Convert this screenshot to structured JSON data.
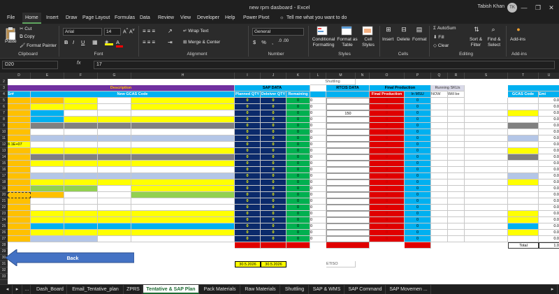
{
  "window": {
    "title": "new rpm dasboard  -  Excel",
    "user": "Tabish Khan",
    "avatar_initials": "TK",
    "minimize": "—",
    "restore": "❐",
    "close": "✕"
  },
  "ribbon_tabs": [
    "File",
    "Home",
    "Insert",
    "Draw",
    "Page Layout",
    "Formulas",
    "Data",
    "Review",
    "View",
    "Developer",
    "Help",
    "Power Pivot"
  ],
  "tell_me": "Tell me what you want to do",
  "ribbon": {
    "clipboard": {
      "paste": "Paste",
      "cut": "Cut",
      "copy": "Copy",
      "format_painter": "Format Painter",
      "label": "Clipboard"
    },
    "font": {
      "name": "Arial",
      "size": "14",
      "label": "Font"
    },
    "alignment": {
      "wrap": "Wrap Text",
      "merge": "Merge & Center",
      "label": "Alignment"
    },
    "number": {
      "format": "General",
      "label": "Number"
    },
    "styles": {
      "conditional": "Conditional Formatting",
      "format_table": "Format as Table",
      "cell_styles": "Cell Styles",
      "label": "Styles"
    },
    "cells": {
      "insert": "Insert",
      "delete": "Delete",
      "format": "Format",
      "label": "Cells"
    },
    "editing": {
      "autosum": "AutoSum",
      "fill": "Fill",
      "clear": "Clear",
      "sort": "Sort & Filter",
      "find": "Find & Select",
      "label": "Editing"
    },
    "addins": {
      "addins": "Add-ins",
      "label": "Add-ins"
    }
  },
  "formula_bar": {
    "name_box": "D20",
    "fx": "fx",
    "value": "17"
  },
  "columns": [
    "D",
    "E",
    "F",
    "G",
    "H",
    "I",
    "J",
    "K",
    "L",
    "M",
    "N",
    "O",
    "P",
    "Q",
    "R",
    "S",
    "T",
    "U"
  ],
  "rows": [
    "1",
    "2",
    "3",
    "4",
    "5",
    "6",
    "7",
    "8",
    "9",
    "10",
    "11",
    "12",
    "13",
    "14",
    "15",
    "16",
    "17",
    "18",
    "19",
    "20",
    "21",
    "22",
    "23",
    "24",
    "25",
    "26",
    "27",
    "28",
    "29",
    "30",
    "31",
    "32",
    "33"
  ],
  "sheet": {
    "shuttling": "Shuttling",
    "description": "Description",
    "new_gcas": "New GCAS Code",
    "sr": "Sr#",
    "sap_data": "SAP DATA",
    "planned_qty": "Planned QTY",
    "delivered_qty": "Deleiver QTY",
    "remaining": "Remaining",
    "rtcis_data": "RTCIS DATA",
    "final_production": "Final Production",
    "in_msu": "In MSU",
    "running_skus": "Running SKUs",
    "now": "NOW",
    "will_be": "Will be",
    "gcas_code": "GCAS Code",
    "emi": "Emi",
    "sci_value": "8.1E+07",
    "rtcis_value": "150",
    "total": "Total",
    "total_value": "1.0",
    "zero": "0",
    "zero_dec": "0.0",
    "date1": "30.5.2026",
    "date2": "30.5.2026",
    "small_note": "ETISO",
    "back": "Back"
  },
  "sheet_tabs": [
    "Dash_Board",
    "Email_Tentative_plan",
    "ZPRS",
    "Tentative & SAP Plan",
    "Pack Materials",
    "Raw Materials",
    "Shuttling",
    "SAP & WMS",
    "SAP Command",
    "SAP Movemen ..."
  ],
  "active_sheet": "Tentative & SAP Plan",
  "colors": {
    "ribbon_bg": "#2b2b2b",
    "excel_green": "#1d6b33",
    "purple_header": "#7030a0",
    "cyan_header": "#00b0f0",
    "navy": "#0b2a6b",
    "green": "#00b050",
    "red": "#e00000",
    "yellow": "#ffff00",
    "orange": "#ffc000",
    "back_blue": "#4472c4"
  }
}
